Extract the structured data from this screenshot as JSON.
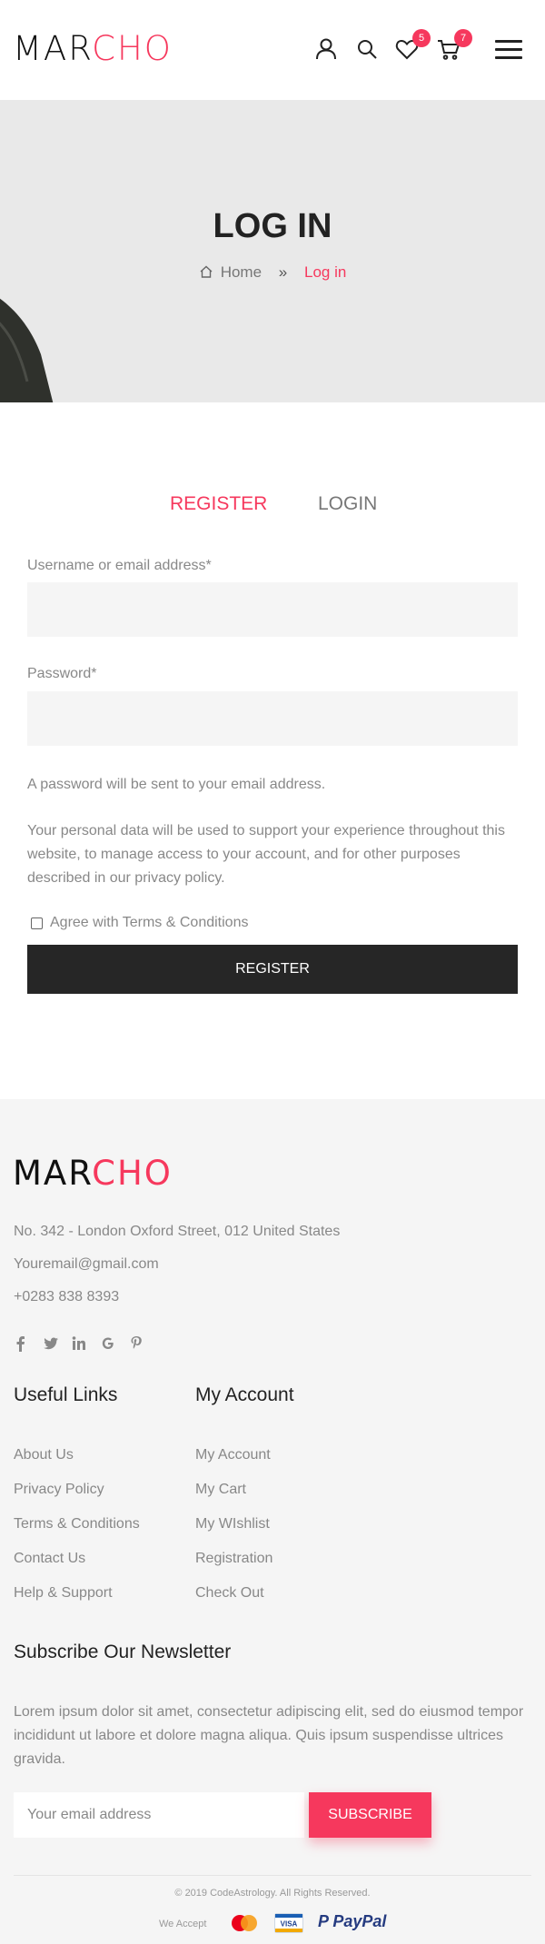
{
  "header": {
    "logo_dark": "MAR",
    "logo_red": "CHO",
    "wishlist_count": "5",
    "cart_count": "7",
    "icons": [
      "user-icon",
      "search-icon",
      "heart-icon",
      "cart-icon",
      "menu-icon"
    ]
  },
  "banner": {
    "title": "LOG IN",
    "breadcrumb_home": "Home",
    "breadcrumb_current": "Log in"
  },
  "tabs": {
    "register": "REGISTER",
    "login": "LOGIN"
  },
  "form": {
    "username_label": "Username or email address*",
    "username_value": "",
    "password_label": "Password*",
    "password_value": "",
    "password_note": "A password will be sent to your email address.",
    "privacy_note": "Your personal data will be used to support your experience throughout this website, to manage access to your account, and for other purposes described in our privacy policy.",
    "agree_label": "Agree with Terms & Conditions",
    "agree_checked": false,
    "register_button": "REGISTER"
  },
  "footer": {
    "logo_dark": "MAR",
    "logo_red": "CHO",
    "address": "No. 342 - London Oxford Street, 012 United States",
    "email": "Youremail@gmail.com",
    "phone": "+0283 838 8393",
    "social_icons": [
      "facebook-icon",
      "twitter-icon",
      "linkedin-icon",
      "google-icon",
      "pinterest-icon"
    ],
    "useful_links_title": "Useful Links",
    "useful_links": [
      "About Us",
      "Privacy Policy",
      "Terms & Conditions",
      "Contact Us",
      "Help & Support"
    ],
    "my_account_title": "My Account",
    "my_account_links": [
      "My Account",
      "My Cart",
      "My WIshlist",
      "Registration",
      "Check Out"
    ],
    "newsletter_title": "Subscribe Our Newsletter",
    "newsletter_text": "Lorem ipsum dolor sit amet, consectetur adipiscing elit, sed do eiusmod tempor incididunt ut labore et dolore magna aliqua. Quis ipsum suspendisse ultrices gravida.",
    "email_placeholder": "Your email address",
    "subscribe_button": "SUBSCRIBE",
    "copyright": "© 2019 CodeAstrology. All Rights Reserved.",
    "we_accept": "We Accept",
    "visa_text": "VISA",
    "paypal_text": "PayPal"
  },
  "colors": {
    "accent": "#f6385d",
    "dark": "#262626",
    "footer_bg": "#f5f5f5",
    "banner_bg": "#e9e9e9"
  }
}
